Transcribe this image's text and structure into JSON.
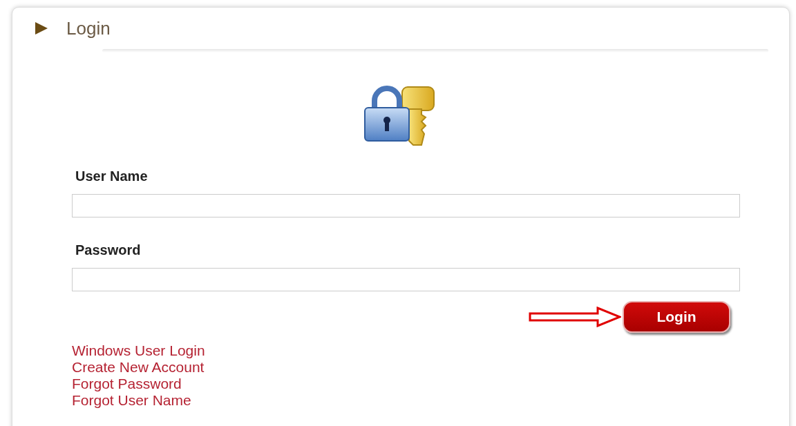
{
  "panel": {
    "title": "Login"
  },
  "fields": [
    {
      "label": "User Name"
    },
    {
      "label": "Password"
    }
  ],
  "login_button": {
    "label": "Login"
  },
  "links": [
    "Windows User Login",
    "Create New Account",
    "Forgot Password",
    "Forgot User Name"
  ]
}
